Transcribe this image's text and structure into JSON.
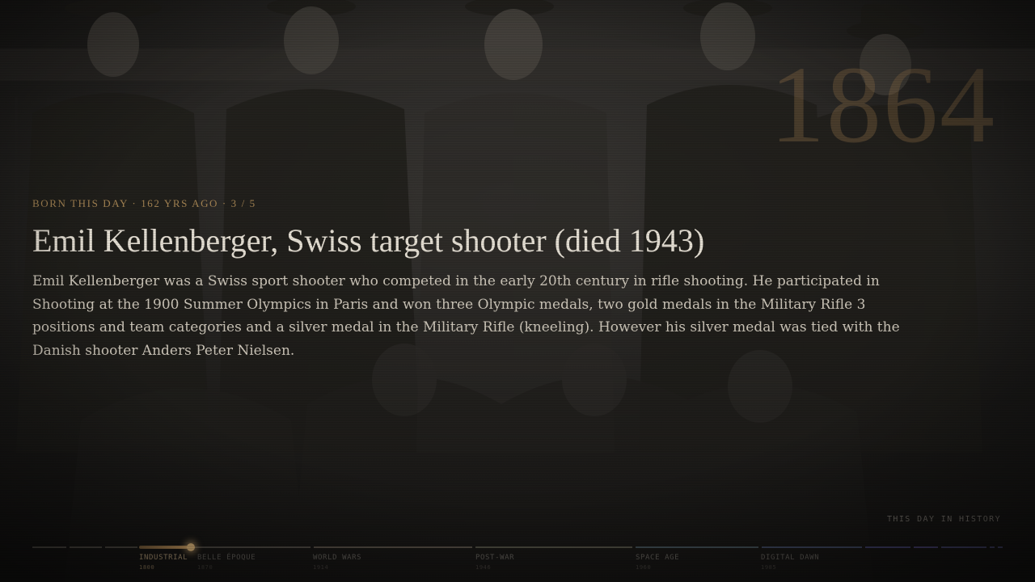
{
  "event": {
    "big_year": "1864",
    "kicker": "BORN THIS DAY · 162 YRS AGO · 3 / 5",
    "headline": "Emil Kellenberger, Swiss target shooter (died 1943)",
    "body": "Emil Kellenberger was a Swiss sport shooter who competed in the early 20th century in rifle shooting. He participated in Shooting at the 1900 Summer Olympics in Paris and won three Olympic medals, two gold medals in the Military Rifle 3 positions and team categories and a silver medal in the Military Rifle (kneeling). However his silver medal was tied with the Danish shooter Anders Peter Nielsen."
  },
  "brand": "THIS DAY IN HISTORY",
  "timeline": {
    "eras": [
      {
        "label": "INDUSTRIAL",
        "year": "1800",
        "active": true
      },
      {
        "label": "BELLE ÉPOQUE",
        "year": "1870",
        "active": false
      },
      {
        "label": "WORLD WARS",
        "year": "1914",
        "active": false
      },
      {
        "label": "POST-WAR",
        "year": "1946",
        "active": false
      },
      {
        "label": "SPACE AGE",
        "year": "1960",
        "active": false
      },
      {
        "label": "DIGITAL DAWN",
        "year": "1985",
        "active": false
      }
    ]
  },
  "colors": {
    "accent": "#c79a5f",
    "kicker": "#a68554",
    "headline": "#e8e2d6"
  }
}
